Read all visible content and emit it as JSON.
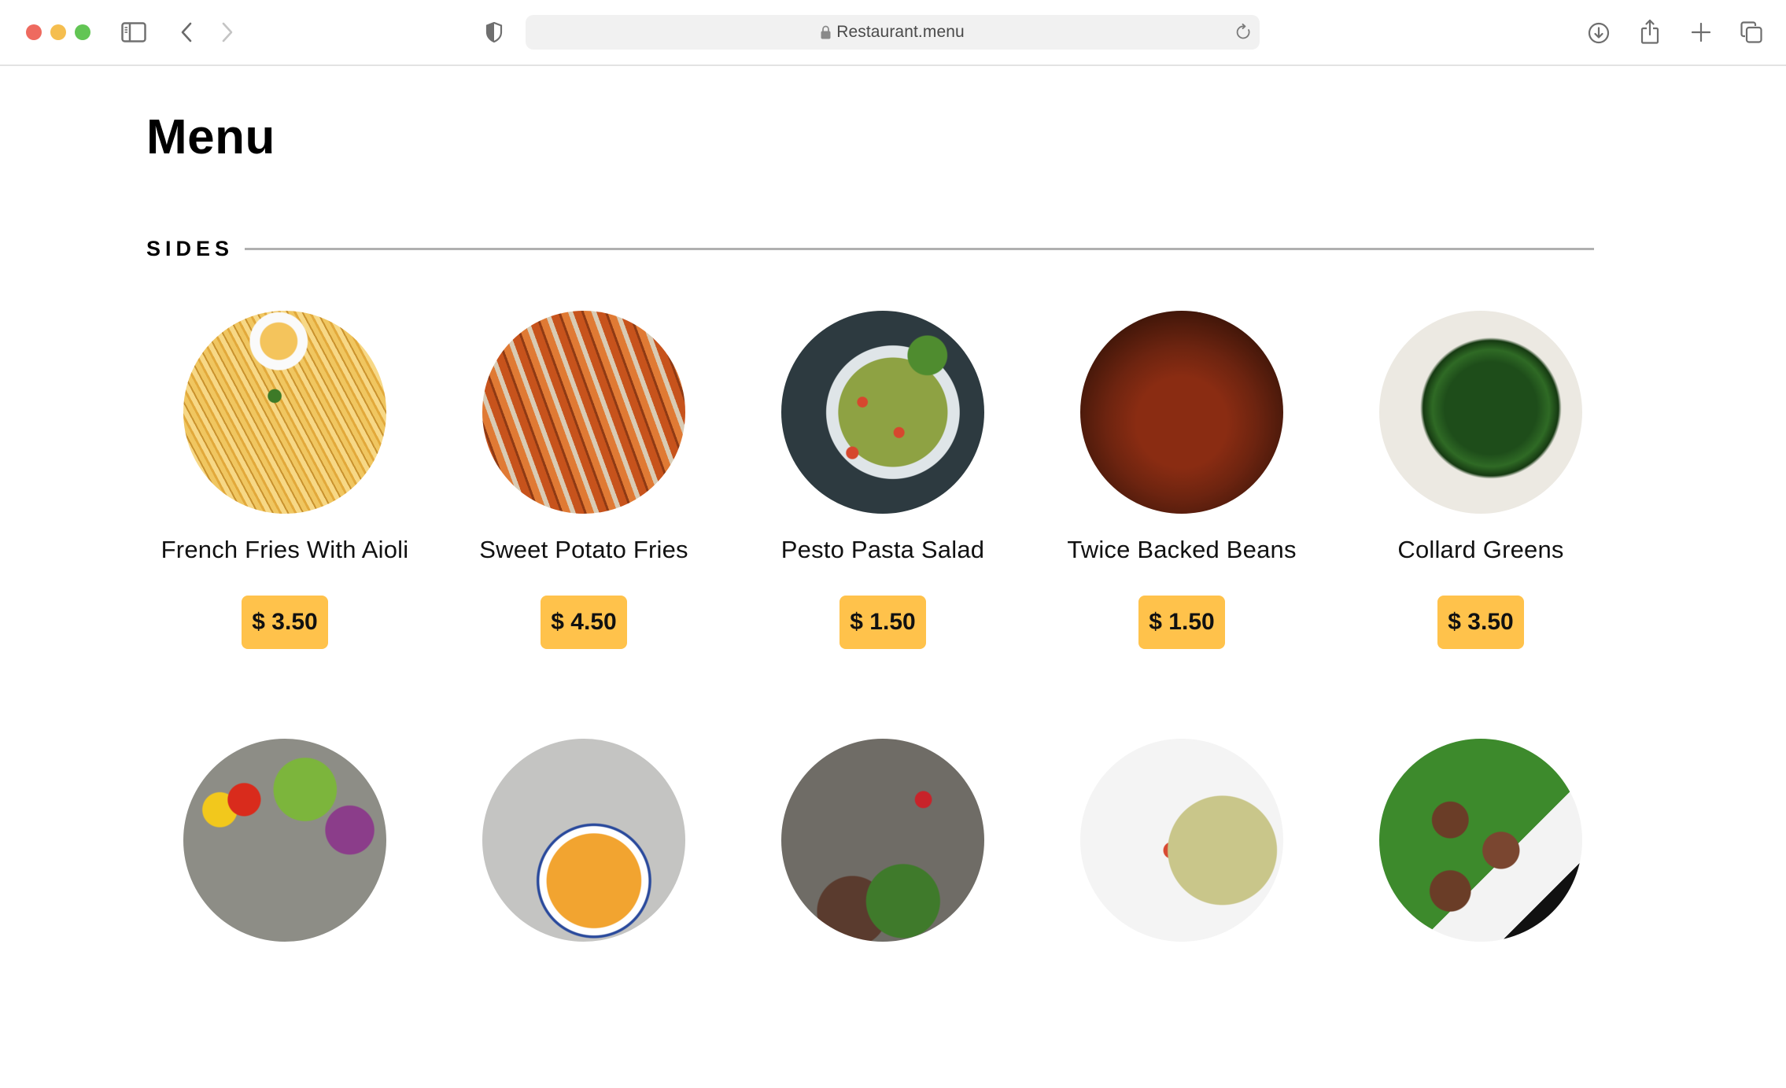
{
  "browser": {
    "url": "Restaurant.menu",
    "icons": {
      "sidebar": "sidebar-icon",
      "back": "chevron-left-icon",
      "forward": "chevron-right-icon",
      "privacy": "shield-icon",
      "lock": "lock-icon",
      "reload": "reload-icon",
      "download": "download-icon",
      "share": "share-icon",
      "new_tab": "plus-icon",
      "tabs": "tabs-overview-icon"
    }
  },
  "page": {
    "title": "Menu",
    "section": {
      "title": "SIDES",
      "items": [
        {
          "name": "French Fries With Aioli",
          "price": "$ 3.50",
          "image": "french-fries"
        },
        {
          "name": "Sweet Potato Fries",
          "price": "$ 4.50",
          "image": "sweet-potato-fries"
        },
        {
          "name": "Pesto Pasta Salad",
          "price": "$ 1.50",
          "image": "pesto-pasta-salad"
        },
        {
          "name": "Twice Backed Beans",
          "price": "$ 1.50",
          "image": "baked-beans"
        },
        {
          "name": "Collard Greens",
          "price": "$ 3.50",
          "image": "collard-greens"
        }
      ],
      "next_row_images": [
        "vegetable-bowl",
        "pumpkin-soup",
        "platter",
        "bowtie-pasta",
        "meatballs"
      ]
    }
  },
  "colors": {
    "price_badge": "#ffc24b",
    "section_rule": "#b0b0b0"
  }
}
